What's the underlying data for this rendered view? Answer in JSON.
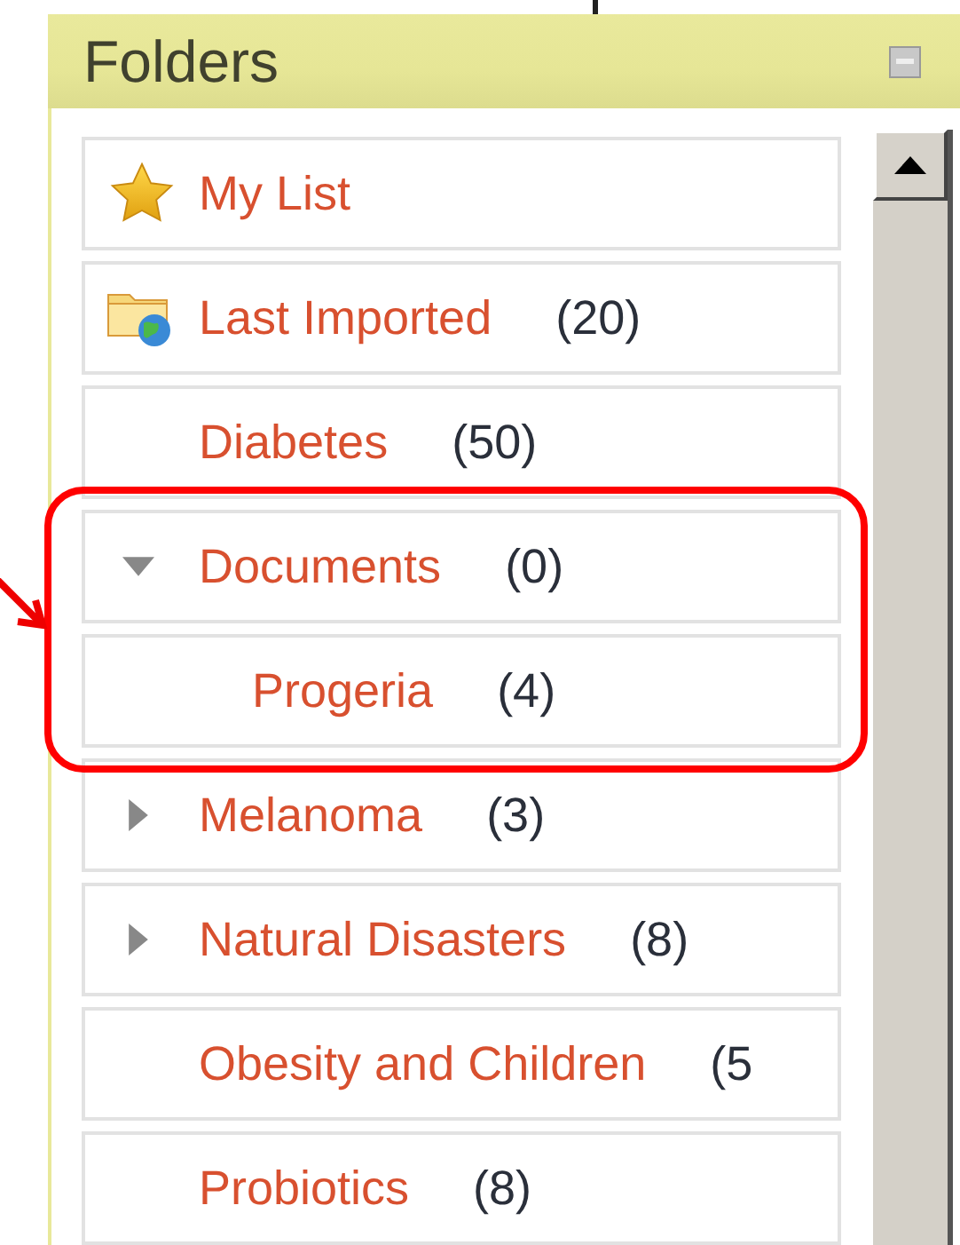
{
  "panel": {
    "title": "Folders"
  },
  "folders": [
    {
      "kind": "favorites",
      "name": "My List"
    },
    {
      "kind": "imported",
      "name": "Last Imported",
      "count": "(20)"
    },
    {
      "name": "Diabetes",
      "count": "(50)"
    },
    {
      "kind": "branch",
      "name": "Documents",
      "count": "(0)",
      "expanded": true,
      "children": [
        {
          "name": "Progeria",
          "count": "(4)"
        }
      ]
    },
    {
      "kind": "branch",
      "name": "Melanoma",
      "count": "(3)",
      "expanded": false
    },
    {
      "kind": "branch",
      "name": "Natural Disasters",
      "count": "(8)",
      "expanded": false
    },
    {
      "name": "Obesity and Children",
      "count": "(5"
    },
    {
      "name": "Probiotics",
      "count": "(8)"
    }
  ]
}
